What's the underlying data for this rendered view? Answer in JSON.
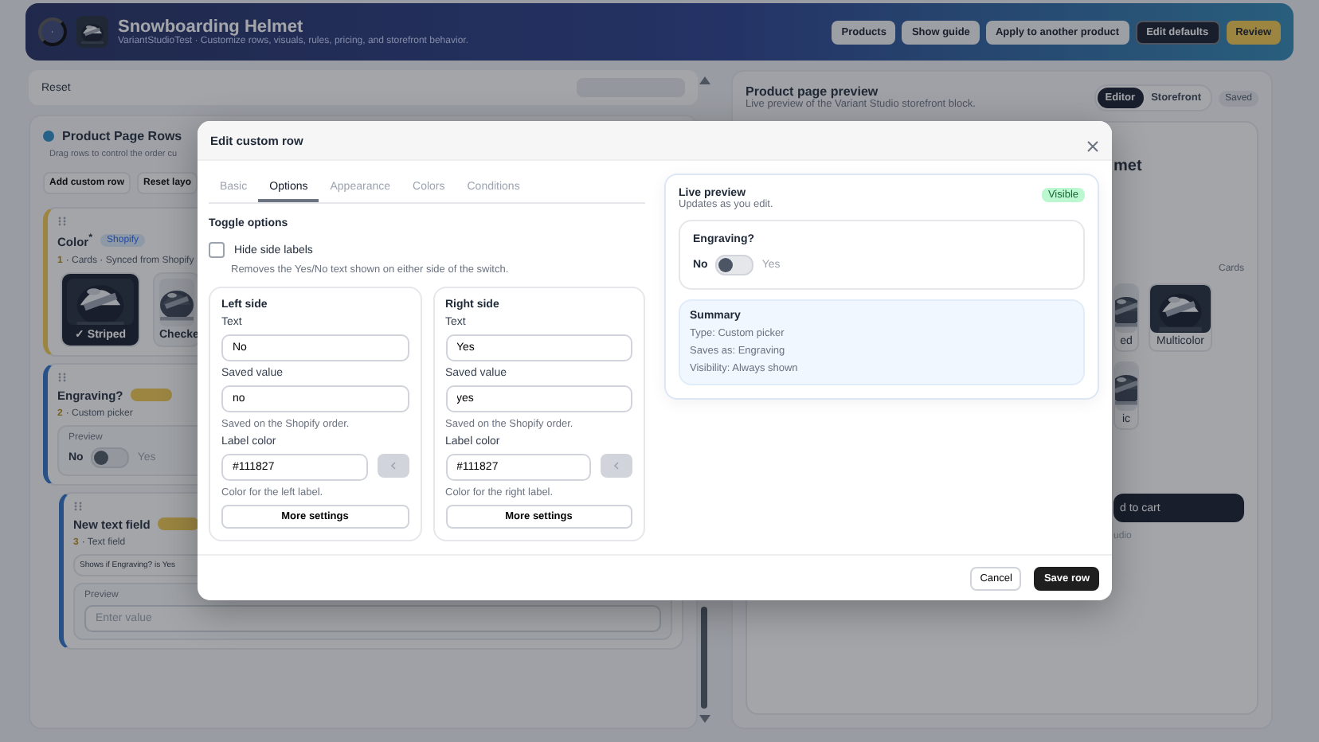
{
  "header": {
    "title": "Snowboarding Helmet",
    "subtitle": "VariantStudioTest · Customize rows, visuals, rules, pricing, and storefront behavior.",
    "buttons": [
      {
        "label": "Products",
        "kind": "light"
      },
      {
        "label": "Show guide",
        "kind": "light"
      },
      {
        "label": "Apply to another product",
        "kind": "light"
      },
      {
        "label": "Edit defaults",
        "kind": "dark"
      },
      {
        "label": "Review",
        "kind": "accent"
      }
    ]
  },
  "toolbar": {
    "reset": "Reset"
  },
  "rows_panel": {
    "title": "Product Page Rows",
    "description": "Drag rows to control the order cu",
    "buttons": [
      "Add custom row",
      "Reset layo"
    ],
    "rows": [
      {
        "kind": "cards",
        "title": "Color$^{*}$",
        "badge": "Shopify",
        "number": "1",
        "meta": "· Cards · Synced from Shopify",
        "swatches": [
          {
            "label": "✓ Striped",
            "selected": true
          },
          {
            "label": "Checke",
            "selected": false
          }
        ]
      },
      {
        "kind": "toggle",
        "title": "Engraving?",
        "number": "2",
        "meta": "· Custom picker",
        "preview_label": "Preview",
        "off_label": "No",
        "on_label": "Yes",
        "on": false
      },
      {
        "kind": "text",
        "title": "New text field",
        "number": "3",
        "meta": "· Text field",
        "condition": "Shows if Engraving? is Yes",
        "preview_label": "Preview",
        "placeholder": "Enter value"
      }
    ]
  },
  "preview_panel": {
    "title": "Product page preview",
    "description": "Live preview of the Variant Studio storefront block.",
    "modes": [
      {
        "label": "Editor",
        "selected": true
      },
      {
        "label": "Storefront",
        "selected": false
      }
    ],
    "status": "Saved",
    "product_title": "met",
    "section_label": "Cards",
    "tiles": [
      {
        "label": "ed"
      },
      {
        "label": "Multicolor"
      },
      {
        "label": "ic"
      }
    ],
    "cart_button": "d to cart",
    "footnote": "udio"
  },
  "modal": {
    "title": "Edit custom row",
    "tabs": [
      {
        "label": "Basic",
        "selected": false
      },
      {
        "label": "Options",
        "selected": true
      },
      {
        "label": "Appearance",
        "selected": false
      },
      {
        "label": "Colors",
        "selected": false
      },
      {
        "label": "Conditions",
        "selected": false
      }
    ],
    "section_title": "Toggle options",
    "hide_labels": {
      "label": "Hide side labels",
      "checked": false,
      "description": "Removes the Yes/No text shown on either side of the switch."
    },
    "sides": [
      {
        "title": "Left side",
        "text_label": "Text",
        "text_value": "No",
        "saved_label": "Saved value",
        "saved_value": "no",
        "saved_help": "Saved on the Shopify order.",
        "color_label": "Label color",
        "color_value": "#111827",
        "color_help": "Color for the left label.",
        "more": "More settings"
      },
      {
        "title": "Right side",
        "text_label": "Text",
        "text_value": "Yes",
        "saved_label": "Saved value",
        "saved_value": "yes",
        "saved_help": "Saved on the Shopify order.",
        "color_label": "Label color",
        "color_value": "#111827",
        "color_help": "Color for the right label.",
        "more": "More settings"
      }
    ],
    "live_preview": {
      "title": "Live preview",
      "subtitle": "Updates as you edit.",
      "badge": "Visible",
      "question": "Engraving?",
      "off_label": "No",
      "on_label": "Yes",
      "on": false,
      "summary_title": "Summary",
      "summary_lines": [
        "Type: Custom picker",
        "Saves as: Engraving",
        "Visibility: Always shown"
      ]
    },
    "footer_buttons": [
      {
        "label": "Cancel",
        "kind": "secondary"
      },
      {
        "label": "Save row",
        "kind": "primary"
      }
    ]
  }
}
